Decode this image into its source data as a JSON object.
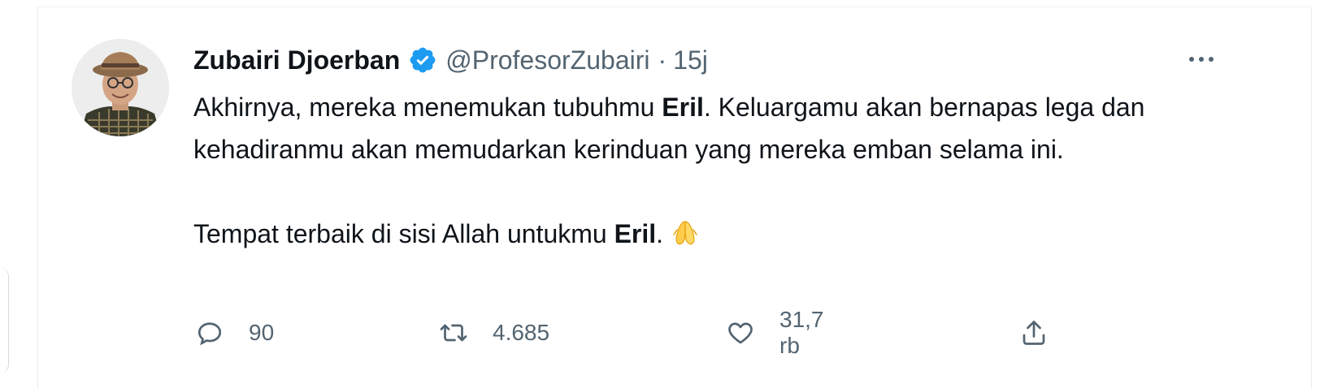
{
  "tweet": {
    "author_name": "Zubairi Djoerban",
    "handle": "@ProfesorZubairi",
    "separator": "·",
    "time": "15j",
    "verified": true,
    "accent_color": "#1d9bf0",
    "text": {
      "line1_a": "Akhirnya, mereka menemukan tubuhmu ",
      "line1_bold": "Eril",
      "line1_b": ". Keluargamu akan bernapas lega dan kehadiranmu akan memudarkan kerinduan yang mereka emban selama ini.",
      "line2_a": "Tempat terbaik di sisi Allah untukmu ",
      "line2_bold": "Eril",
      "line2_b": ".",
      "emoji": "🙏"
    },
    "stats": {
      "replies": "90",
      "retweets": "4.685",
      "likes": "31,7 rb"
    },
    "icons": {
      "reply": "reply-icon",
      "retweet": "retweet-icon",
      "like": "heart-icon",
      "share": "share-icon",
      "more": "more-icon",
      "verified": "verified-badge-icon"
    }
  }
}
